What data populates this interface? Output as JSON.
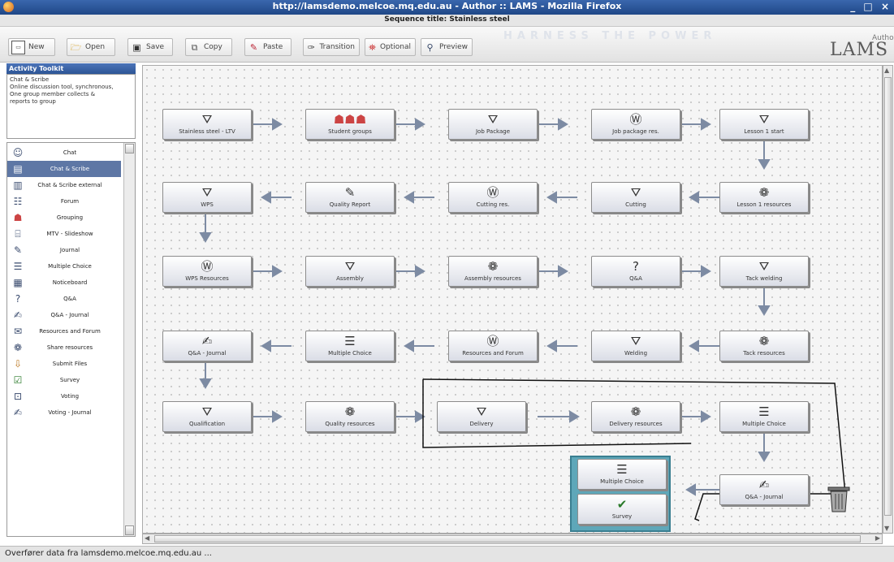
{
  "window": {
    "title": "http://lamsdemo.melcoe.mq.edu.au - Author :: LAMS - Mozilla Firefox",
    "controls": "_ □ ×"
  },
  "sequence": {
    "title": "Sequence title: Stainless steel"
  },
  "toolbar": {
    "buttons": [
      {
        "label": "New",
        "icon": "new-document-icon"
      },
      {
        "label": "Open",
        "icon": "open-folder-icon"
      },
      {
        "label": "Save",
        "icon": "save-disk-icon"
      },
      {
        "label": "Copy",
        "icon": "copy-icon"
      },
      {
        "label": "Paste",
        "icon": "paste-icon"
      },
      {
        "label": "Transition",
        "icon": "transition-pen-icon"
      },
      {
        "label": "Optional",
        "icon": "optional-icon"
      },
      {
        "label": "Preview",
        "icon": "preview-magnifier-icon"
      }
    ]
  },
  "brand": {
    "logo": "LAMS",
    "role": "Author",
    "tagline": "HARNESS THE POWER"
  },
  "toolkit": {
    "header": "Activity Toolkit",
    "description": "Chat & Scribe\nOnline discussion tool, synchronous,\nOne group member collects &\nreports to group",
    "items": [
      {
        "label": "Chat",
        "icon": "chat-icon"
      },
      {
        "label": "Chat & Scribe",
        "icon": "chat-scribe-icon",
        "selected": true
      },
      {
        "label": "Chat & Scribe external",
        "icon": "chat-scribe-external-icon"
      },
      {
        "label": "Forum",
        "icon": "forum-icon"
      },
      {
        "label": "Grouping",
        "icon": "grouping-icon"
      },
      {
        "label": "MTV - Slideshow",
        "icon": "slideshow-icon"
      },
      {
        "label": "Journal",
        "icon": "journal-icon"
      },
      {
        "label": "Multiple Choice",
        "icon": "multiple-choice-icon"
      },
      {
        "label": "Noticeboard",
        "icon": "noticeboard-icon"
      },
      {
        "label": "Q&A",
        "icon": "qa-icon"
      },
      {
        "label": "Q&A - Journal",
        "icon": "qa-journal-icon"
      },
      {
        "label": "Resources and Forum",
        "icon": "resources-forum-icon"
      },
      {
        "label": "Share resources",
        "icon": "share-resources-icon"
      },
      {
        "label": "Submit Files",
        "icon": "submit-files-icon"
      },
      {
        "label": "Survey",
        "icon": "survey-icon"
      },
      {
        "label": "Voting",
        "icon": "voting-icon"
      },
      {
        "label": "Voting - Journal",
        "icon": "voting-journal-icon"
      }
    ]
  },
  "activities": [
    {
      "label": "Stainless steel - LTV",
      "icon": "easel-icon"
    },
    {
      "label": "Student groups",
      "icon": "grouping-icon"
    },
    {
      "label": "Job Package",
      "icon": "easel-icon"
    },
    {
      "label": "Job package res.",
      "icon": "resources-icon"
    },
    {
      "label": "Lesson 1 start",
      "icon": "easel-icon"
    },
    {
      "label": "WPS",
      "icon": "easel-icon"
    },
    {
      "label": "Quality Report",
      "icon": "journal-icon"
    },
    {
      "label": "Cutting res.",
      "icon": "resources-icon"
    },
    {
      "label": "Cutting",
      "icon": "easel-icon"
    },
    {
      "label": "Lesson 1 resources",
      "icon": "share-resources-icon"
    },
    {
      "label": "WPS Resources",
      "icon": "resources-icon"
    },
    {
      "label": "Assembly",
      "icon": "easel-icon"
    },
    {
      "label": "Assembly resources",
      "icon": "share-resources-icon"
    },
    {
      "label": "Q&A",
      "icon": "qa-icon"
    },
    {
      "label": "Tack welding",
      "icon": "easel-icon"
    },
    {
      "label": "Q&A - Journal",
      "icon": "qa-journal-icon"
    },
    {
      "label": "Multiple Choice",
      "icon": "multiple-choice-icon"
    },
    {
      "label": "Resources and Forum",
      "icon": "resources-icon"
    },
    {
      "label": "Welding",
      "icon": "easel-icon"
    },
    {
      "label": "Tack resources",
      "icon": "share-resources-icon"
    },
    {
      "label": "Qualification",
      "icon": "easel-icon"
    },
    {
      "label": "Quality resources",
      "icon": "share-resources-icon"
    },
    {
      "label": "Delivery",
      "icon": "easel-icon"
    },
    {
      "label": "Delivery resources",
      "icon": "share-resources-icon"
    },
    {
      "label": "Multiple Choice",
      "icon": "multiple-choice-icon"
    },
    {
      "label": "Q&A - Journal",
      "icon": "qa-journal-icon"
    },
    {
      "label": "Multiple Choice",
      "icon": "multiple-choice-icon"
    },
    {
      "label": "Survey",
      "icon": "survey-icon"
    }
  ],
  "status": {
    "text": "Overfører data fra lamsdemo.melcoe.mq.edu.au ..."
  }
}
